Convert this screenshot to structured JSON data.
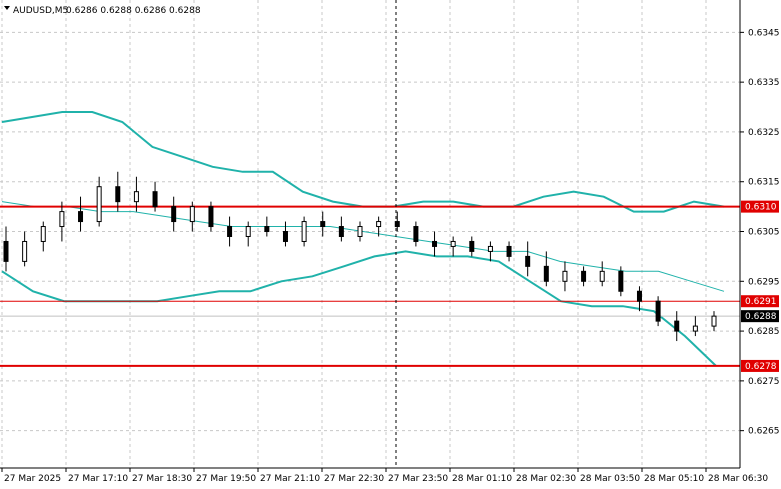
{
  "header": {
    "symbol_label": "AUDUSD,M5",
    "ohlc_label": "0.6286 0.6288 0.6286 0.6288"
  },
  "colors": {
    "background": "#ffffff",
    "grid": "#c8c8c8",
    "candle": "#000000",
    "bollinger_outer": "#20b2aa",
    "bollinger_middle": "#20b2aa",
    "level_line": "#e00000",
    "current_price_badge": "#000000",
    "crosshair": "#000000"
  },
  "chart_data": {
    "type": "candlestick",
    "symbol": "AUDUSD",
    "timeframe": "M5",
    "y_ticks": [
      0.6345,
      0.6335,
      0.6325,
      0.6315,
      0.6305,
      0.6295,
      0.6285,
      0.6275,
      0.6265
    ],
    "y_tick_labels": [
      "0.6345",
      "0.6335",
      "0.6325",
      "0.6315",
      "0.6305",
      "0.6295",
      "0.6285",
      "0.6275",
      "0.6265"
    ],
    "ylim": [
      0.62575,
      0.63515
    ],
    "x_tick_labels": [
      "27 Mar 2025",
      "27 Mar 17:10",
      "27 Mar 18:30",
      "27 Mar 19:50",
      "27 Mar 21:10",
      "27 Mar 22:30",
      "27 Mar 23:50",
      "28 Mar 01:10",
      "28 Mar 02:30",
      "28 Mar 03:50",
      "28 Mar 05:10",
      "28 Mar 06:30"
    ],
    "horizontal_levels": [
      {
        "label": "0.6310",
        "value": 0.631,
        "style": "thick"
      },
      {
        "label": "0.6291",
        "value": 0.6291,
        "style": "thin"
      },
      {
        "label": "0.6278",
        "value": 0.6278,
        "style": "thick"
      }
    ],
    "current_price": {
      "label": "0.6288",
      "value": 0.6288
    },
    "crosshair_x_label": "27 Mar 23:50",
    "bollinger_upper": [
      0.6327,
      0.6328,
      0.6329,
      0.6329,
      0.6327,
      0.6322,
      0.632,
      0.6318,
      0.6317,
      0.6317,
      0.6313,
      0.6311,
      0.631,
      0.631,
      0.6311,
      0.6311,
      0.631,
      0.631,
      0.6312,
      0.6313,
      0.6312,
      0.6309,
      0.6309,
      0.6311,
      0.631
    ],
    "bollinger_middle": [
      0.6311,
      0.631,
      0.631,
      0.6309,
      0.6309,
      0.6308,
      0.6307,
      0.6306,
      0.6306,
      0.6306,
      0.6306,
      0.6305,
      0.6304,
      0.6303,
      0.6302,
      0.6301,
      0.6301,
      0.6299,
      0.6298,
      0.6297,
      0.6297,
      0.6295,
      0.6293
    ],
    "bollinger_lower": [
      0.6297,
      0.6293,
      0.6291,
      0.6291,
      0.6291,
      0.6291,
      0.6292,
      0.6293,
      0.6293,
      0.6295,
      0.6296,
      0.6298,
      0.63,
      0.6301,
      0.63,
      0.63,
      0.6299,
      0.6295,
      0.6291,
      0.629,
      0.629,
      0.6289,
      0.6284,
      0.6278
    ],
    "candles": [
      {
        "o": 0.6303,
        "h": 0.6306,
        "l": 0.6297,
        "c": 0.6299
      },
      {
        "o": 0.6299,
        "h": 0.6305,
        "l": 0.6298,
        "c": 0.6303
      },
      {
        "o": 0.6303,
        "h": 0.6307,
        "l": 0.6301,
        "c": 0.6306
      },
      {
        "o": 0.6306,
        "h": 0.6311,
        "l": 0.6303,
        "c": 0.6309
      },
      {
        "o": 0.6309,
        "h": 0.6312,
        "l": 0.6305,
        "c": 0.6307
      },
      {
        "o": 0.6307,
        "h": 0.6316,
        "l": 0.6306,
        "c": 0.6314
      },
      {
        "o": 0.6314,
        "h": 0.6317,
        "l": 0.6309,
        "c": 0.6311
      },
      {
        "o": 0.6311,
        "h": 0.6316,
        "l": 0.6309,
        "c": 0.6313
      },
      {
        "o": 0.6313,
        "h": 0.6315,
        "l": 0.6309,
        "c": 0.631
      },
      {
        "o": 0.631,
        "h": 0.6312,
        "l": 0.6305,
        "c": 0.6307
      },
      {
        "o": 0.6307,
        "h": 0.6311,
        "l": 0.6305,
        "c": 0.631
      },
      {
        "o": 0.631,
        "h": 0.6311,
        "l": 0.6305,
        "c": 0.6306
      },
      {
        "o": 0.6306,
        "h": 0.6308,
        "l": 0.6302,
        "c": 0.6304
      },
      {
        "o": 0.6304,
        "h": 0.6307,
        "l": 0.6302,
        "c": 0.6306
      },
      {
        "o": 0.6306,
        "h": 0.6308,
        "l": 0.6304,
        "c": 0.6305
      },
      {
        "o": 0.6305,
        "h": 0.6307,
        "l": 0.6302,
        "c": 0.6303
      },
      {
        "o": 0.6303,
        "h": 0.6308,
        "l": 0.6302,
        "c": 0.6307
      },
      {
        "o": 0.6307,
        "h": 0.6309,
        "l": 0.6304,
        "c": 0.6306
      },
      {
        "o": 0.6306,
        "h": 0.6308,
        "l": 0.6303,
        "c": 0.6304
      },
      {
        "o": 0.6304,
        "h": 0.6307,
        "l": 0.6303,
        "c": 0.6306
      },
      {
        "o": 0.6306,
        "h": 0.6308,
        "l": 0.6304,
        "c": 0.6307
      },
      {
        "o": 0.6307,
        "h": 0.6309,
        "l": 0.6305,
        "c": 0.6306
      },
      {
        "o": 0.6306,
        "h": 0.6307,
        "l": 0.6302,
        "c": 0.6303
      },
      {
        "o": 0.6303,
        "h": 0.6305,
        "l": 0.63,
        "c": 0.6302
      },
      {
        "o": 0.6302,
        "h": 0.6304,
        "l": 0.63,
        "c": 0.6303
      },
      {
        "o": 0.6303,
        "h": 0.6304,
        "l": 0.63,
        "c": 0.6301
      },
      {
        "o": 0.6301,
        "h": 0.6303,
        "l": 0.6299,
        "c": 0.6302
      },
      {
        "o": 0.6302,
        "h": 0.6303,
        "l": 0.6299,
        "c": 0.63
      },
      {
        "o": 0.63,
        "h": 0.6303,
        "l": 0.6296,
        "c": 0.6298
      },
      {
        "o": 0.6298,
        "h": 0.6301,
        "l": 0.6294,
        "c": 0.6295
      },
      {
        "o": 0.6295,
        "h": 0.6299,
        "l": 0.6293,
        "c": 0.6297
      },
      {
        "o": 0.6297,
        "h": 0.6298,
        "l": 0.6294,
        "c": 0.6295
      },
      {
        "o": 0.6295,
        "h": 0.6299,
        "l": 0.6294,
        "c": 0.6297
      },
      {
        "o": 0.6297,
        "h": 0.6298,
        "l": 0.6292,
        "c": 0.6293
      },
      {
        "o": 0.6293,
        "h": 0.6294,
        "l": 0.6289,
        "c": 0.6291
      },
      {
        "o": 0.6291,
        "h": 0.6292,
        "l": 0.6286,
        "c": 0.6287
      },
      {
        "o": 0.6287,
        "h": 0.6289,
        "l": 0.6283,
        "c": 0.6285
      },
      {
        "o": 0.6285,
        "h": 0.6288,
        "l": 0.6284,
        "c": 0.6286
      },
      {
        "o": 0.6286,
        "h": 0.6289,
        "l": 0.6285,
        "c": 0.6288
      }
    ]
  }
}
